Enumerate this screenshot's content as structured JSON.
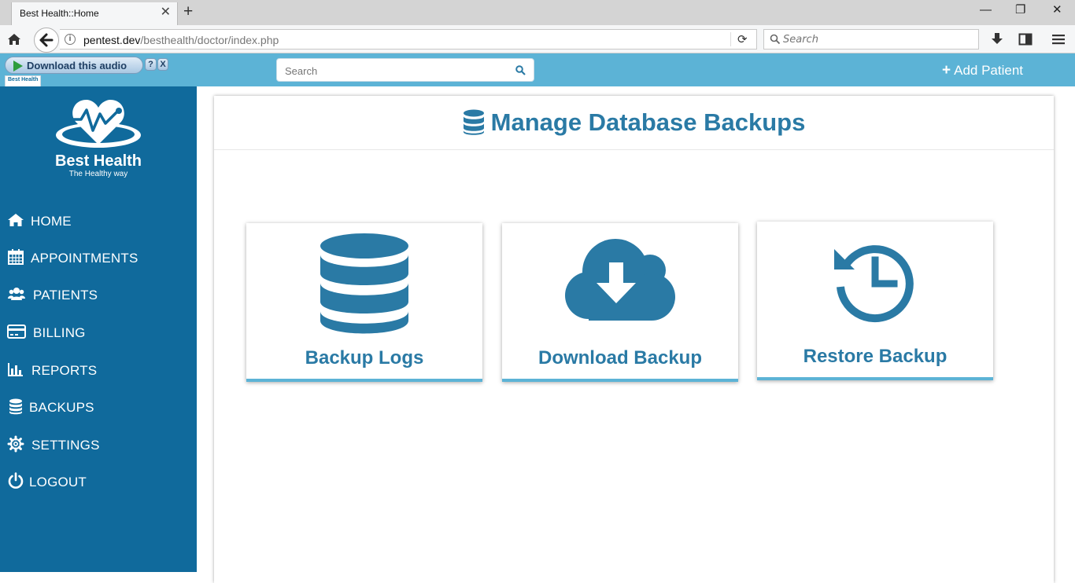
{
  "browser": {
    "tab_title": "Best Health::Home",
    "tab_close": "✕",
    "new_tab": "+",
    "url_host": "pentest.dev",
    "url_path": "/besthealth/doctor/index.php",
    "search_placeholder": "Search",
    "window_controls": {
      "minimize": "—",
      "restore": "❐",
      "close": "✕"
    }
  },
  "audio_widget": {
    "label": "Download this audio",
    "help": "?",
    "close": "X",
    "mini_logo_text": "Best Health"
  },
  "header": {
    "search_placeholder": "Search",
    "add_patient_icon": "+",
    "add_patient_label": "Add Patient"
  },
  "brand": {
    "name": "Best Health",
    "tagline": "The Healthy way"
  },
  "sidebar": {
    "items": [
      {
        "label": "HOME",
        "icon": "home-icon"
      },
      {
        "label": "APPOINTMENTS",
        "icon": "calendar-icon"
      },
      {
        "label": "PATIENTS",
        "icon": "users-icon"
      },
      {
        "label": "BILLING",
        "icon": "credit-card-icon"
      },
      {
        "label": "REPORTS",
        "icon": "bar-chart-icon"
      },
      {
        "label": "BACKUPS",
        "icon": "database-icon"
      },
      {
        "label": "SETTINGS",
        "icon": "gear-icon"
      },
      {
        "label": "LOGOUT",
        "icon": "power-icon"
      }
    ]
  },
  "main": {
    "title": "Manage Database Backups",
    "title_icon": "database-icon",
    "cards": [
      {
        "label": "Backup Logs",
        "icon": "database-icon"
      },
      {
        "label": "Download Backup",
        "icon": "cloud-download-icon"
      },
      {
        "label": "Restore Backup",
        "icon": "history-icon"
      }
    ]
  },
  "colors": {
    "header_bg": "#5cb3d6",
    "sidebar_bg": "#106a9c",
    "accent_text": "#2a7aa5"
  }
}
